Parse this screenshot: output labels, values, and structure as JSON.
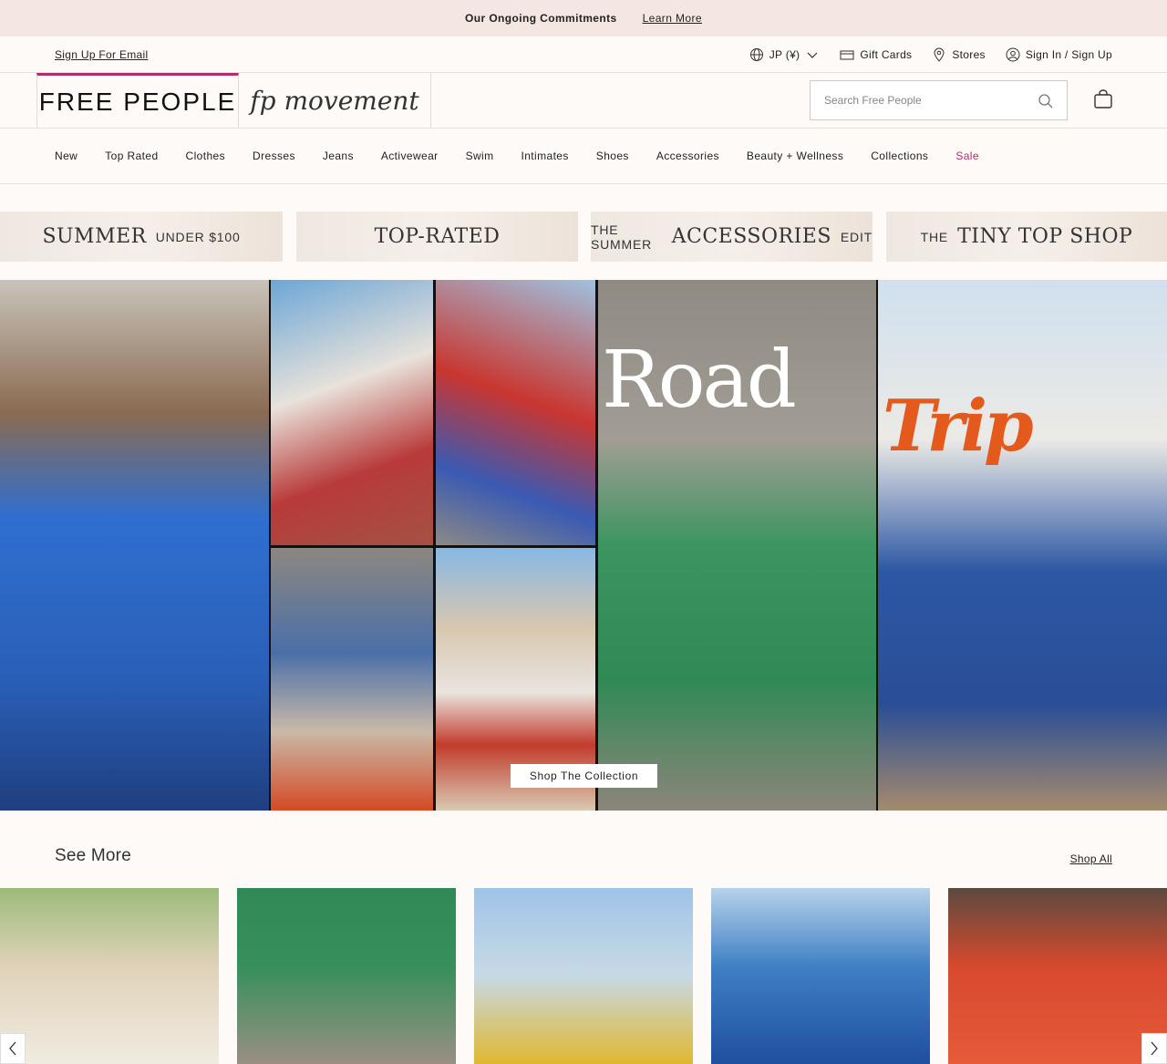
{
  "announcement": {
    "commitments": "Our Ongoing Commitments",
    "learn_more": "Learn More"
  },
  "utility": {
    "signup": "Sign Up For Email",
    "locale": "JP (¥)",
    "gift_cards": "Gift Cards",
    "stores": "Stores",
    "signin": "Sign In / Sign Up"
  },
  "logos": {
    "free_people": "FREE PEOPLE",
    "fp_movement": "fp movement"
  },
  "search": {
    "placeholder": "Search Free People"
  },
  "nav": {
    "items": [
      "New",
      "Top Rated",
      "Clothes",
      "Dresses",
      "Jeans",
      "Activewear",
      "Swim",
      "Intimates",
      "Shoes",
      "Accessories",
      "Beauty + Wellness",
      "Collections",
      "Sale"
    ]
  },
  "banners": [
    {
      "big": "SUMMER",
      "small_after": "UNDER $100"
    },
    {
      "big": "TOP-RATED"
    },
    {
      "small_before": "THE SUMMER",
      "big": "ACCESSORIES",
      "small_after": "EDIT"
    },
    {
      "small_before": "THE",
      "big": "TINY TOP SHOP"
    }
  ],
  "hero": {
    "road": "Road",
    "trip": "Trip",
    "cta": "Shop The Collection"
  },
  "see_more": {
    "title": "See More",
    "shop_all": "Shop All"
  },
  "colors": {
    "accent": "#b22d6f",
    "trip": "#e45a1c",
    "announce_bg": "#f4e6e0"
  }
}
